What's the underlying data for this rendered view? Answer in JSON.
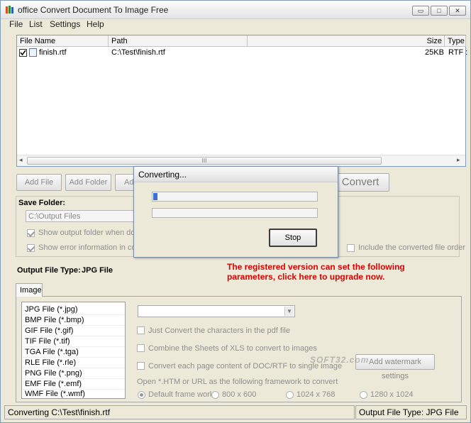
{
  "window": {
    "title": "office Convert Document To Image Free",
    "min_btn": "▭",
    "max_btn": "□",
    "close_btn": "✕"
  },
  "menu": [
    "File",
    "List",
    "Settings",
    "Help"
  ],
  "list": {
    "headers": {
      "name": "File Name",
      "path": "Path",
      "size": "Size",
      "type": "Type"
    },
    "rows": [
      {
        "name": "finish.rtf",
        "path": "C:\\Test\\finish.rtf",
        "size": "25KB",
        "type": "RTF :"
      }
    ],
    "scroll_grip": "III"
  },
  "buttons": {
    "add_file": "Add File",
    "add_folder": "Add Folder",
    "add_partial": "Ad",
    "convert": "Convert"
  },
  "save": {
    "label": "Save Folder:",
    "path": "C:\\Output Files",
    "show_output": "Show output folder when done",
    "show_error": "Show error information in convers",
    "include_order": "Include the converted file order"
  },
  "output": {
    "label": "Output File Type:",
    "value": "JPG File",
    "promo_line1": "The registered version can set the following",
    "promo_line2": "parameters, click here to upgrade now."
  },
  "tabs": [
    "Image"
  ],
  "file_types": [
    "JPG File  (*.jpg)",
    "BMP File  (*.bmp)",
    "GIF File  (*.gif)",
    "TIF File  (*.tif)",
    "TGA File  (*.tga)",
    "RLE File  (*.rle)",
    "PNG File  (*.png)",
    "EMF File  (*.emf)",
    "WMF File  (*.wmf)"
  ],
  "options": {
    "just_convert": "Just Convert the characters in the pdf file",
    "combine_sheets": "Combine the Sheets of XLS to convert to images",
    "each_page": "Convert each page content of DOC/RTF to single image",
    "watermark_btn": "Add watermark settings",
    "open_htm": "Open *.HTM or URL as the following framework to convert",
    "radios": [
      "Default frame work",
      "800 x 600",
      "1024 x 768",
      "1280 x 1024"
    ]
  },
  "watermark_overlay": "SOFT32.com",
  "dialog": {
    "title": "Converting...",
    "progress1": 0.02,
    "progress2": 0,
    "stop": "Stop"
  },
  "status": {
    "left": "Converting  C:\\Test\\finish.rtf",
    "right": "Output File Type:  JPG File"
  },
  "colors": {
    "promo": "#e00000",
    "progress_fill": "#3a6fd8"
  }
}
